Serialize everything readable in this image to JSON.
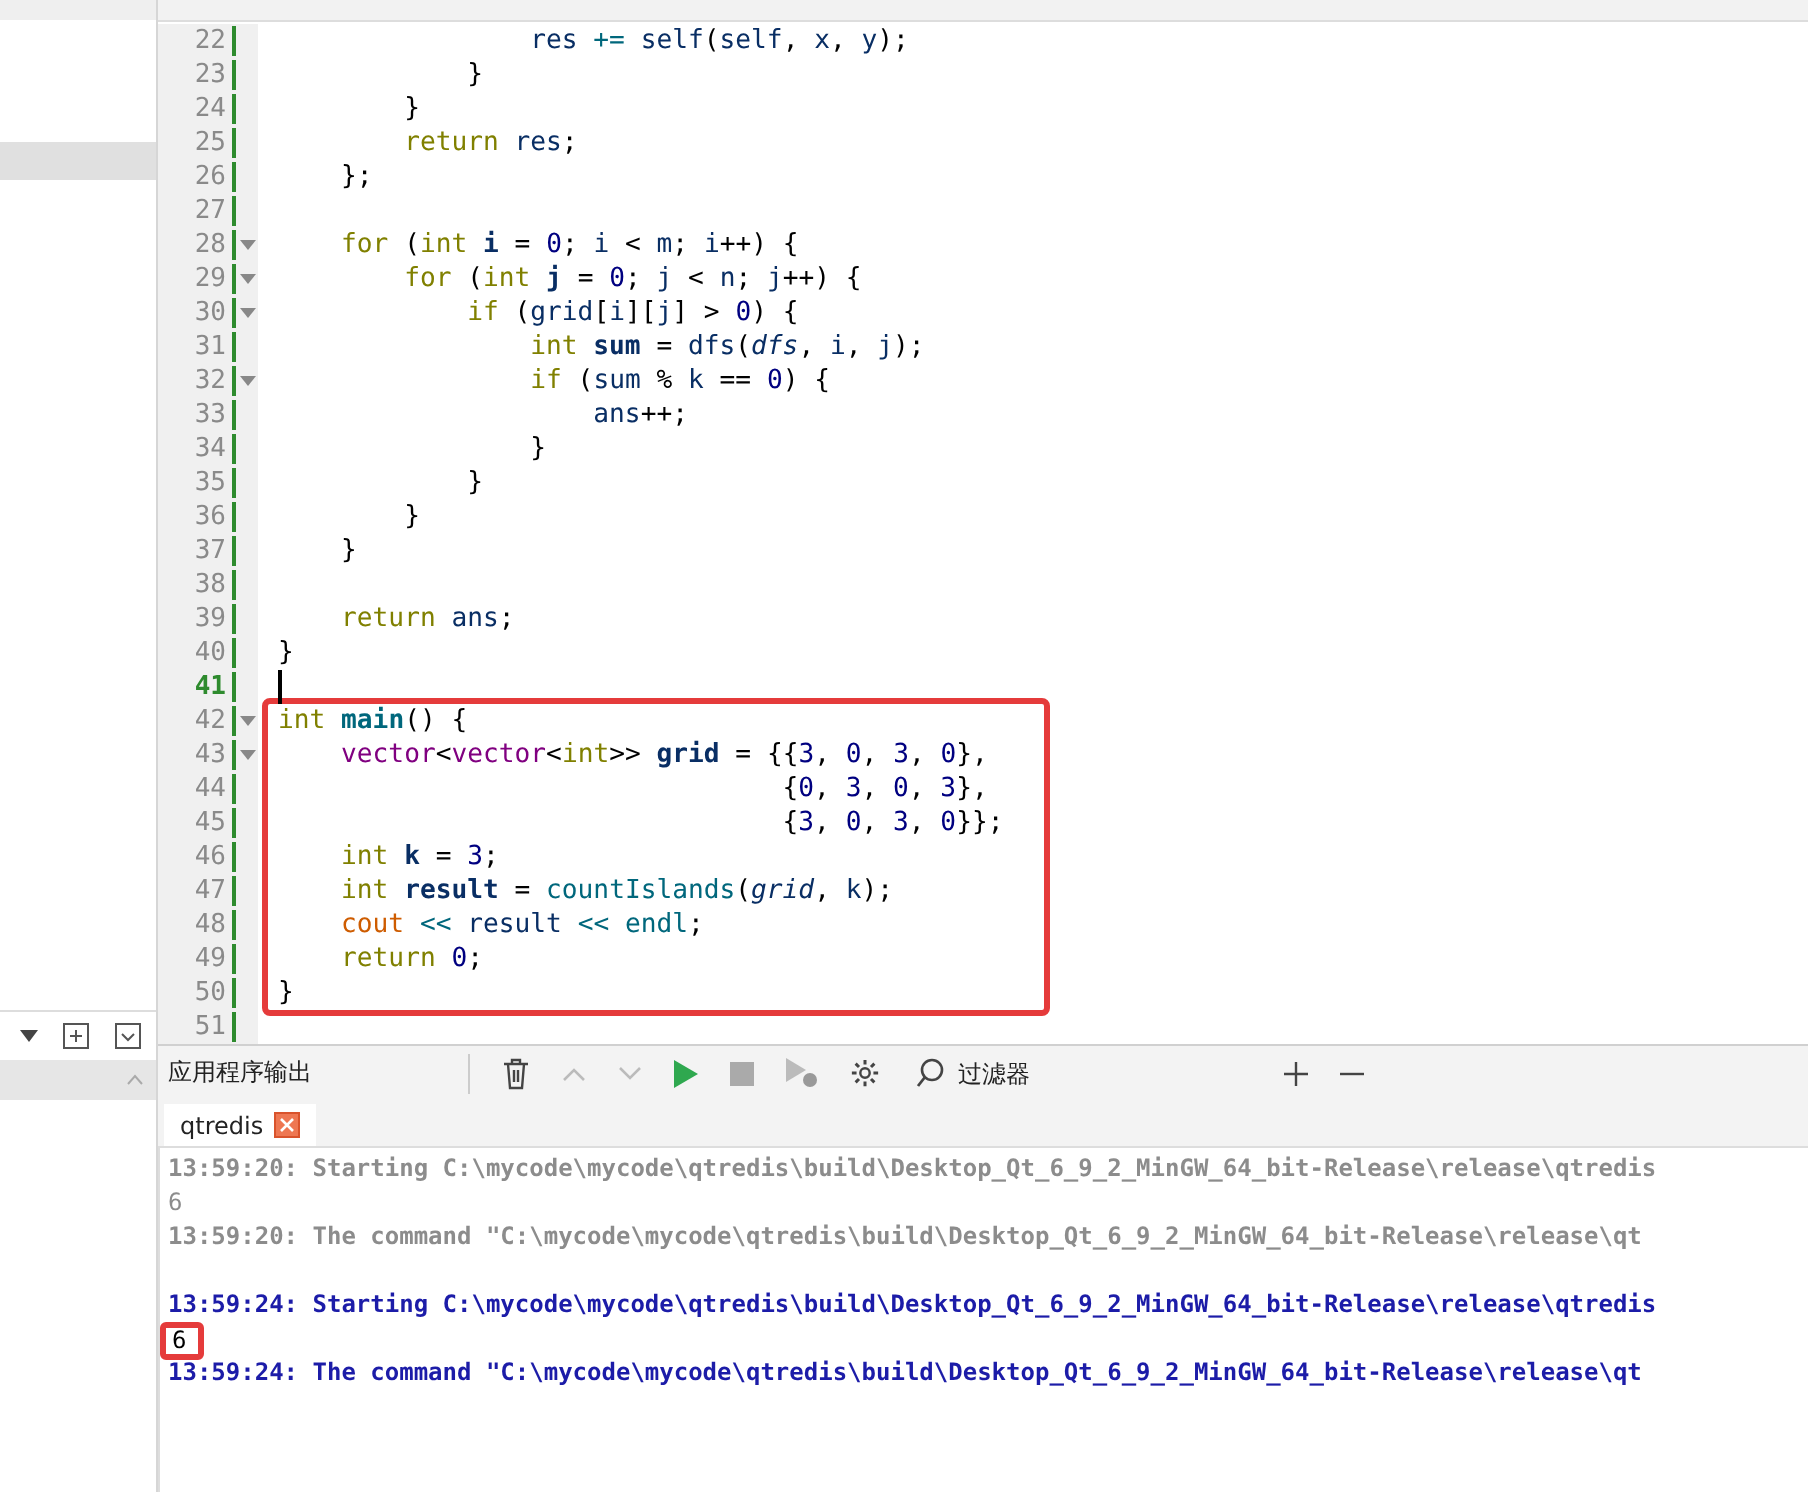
{
  "editor": {
    "lines": [
      {
        "number": "22",
        "fold": false,
        "current": false,
        "boxed": false,
        "tokens": [
          {
            "kind": "var",
            "text": "                res"
          },
          {
            "kind": "op",
            "text": " += "
          },
          {
            "kind": "var",
            "text": "self"
          },
          {
            "kind": "p",
            "text": "("
          },
          {
            "kind": "var",
            "text": "self"
          },
          {
            "kind": "p",
            "text": ", "
          },
          {
            "kind": "var",
            "text": "x"
          },
          {
            "kind": "p",
            "text": ", "
          },
          {
            "kind": "var",
            "text": "y"
          },
          {
            "kind": "p",
            "text": ");"
          }
        ]
      },
      {
        "number": "23",
        "fold": false,
        "current": false,
        "boxed": false,
        "tokens": [
          {
            "kind": "p",
            "text": "            }"
          }
        ]
      },
      {
        "number": "24",
        "fold": false,
        "current": false,
        "boxed": false,
        "tokens": [
          {
            "kind": "p",
            "text": "        }"
          }
        ]
      },
      {
        "number": "25",
        "fold": false,
        "current": false,
        "boxed": false,
        "tokens": [
          {
            "kind": "kw",
            "text": "        return"
          },
          {
            "kind": "var",
            "text": " res"
          },
          {
            "kind": "p",
            "text": ";"
          }
        ]
      },
      {
        "number": "26",
        "fold": false,
        "current": false,
        "boxed": false,
        "tokens": [
          {
            "kind": "p",
            "text": "    };"
          }
        ]
      },
      {
        "number": "27",
        "fold": false,
        "current": false,
        "boxed": false
      },
      {
        "number": "28",
        "fold": true,
        "current": false,
        "boxed": false,
        "tokens": [
          {
            "kind": "kw",
            "text": "    for"
          },
          {
            "kind": "p",
            "text": " ("
          },
          {
            "kind": "kw",
            "text": "int"
          },
          {
            "kind": "decl",
            "text": " i"
          },
          {
            "kind": "p",
            "text": " = "
          },
          {
            "kind": "num",
            "text": "0"
          },
          {
            "kind": "p",
            "text": "; "
          },
          {
            "kind": "var",
            "text": "i"
          },
          {
            "kind": "p",
            "text": " < "
          },
          {
            "kind": "var",
            "text": "m"
          },
          {
            "kind": "p",
            "text": "; "
          },
          {
            "kind": "var",
            "text": "i"
          },
          {
            "kind": "p",
            "text": "++) {"
          }
        ]
      },
      {
        "number": "29",
        "fold": true,
        "current": false,
        "boxed": false,
        "tokens": [
          {
            "kind": "kw",
            "text": "        for"
          },
          {
            "kind": "p",
            "text": " ("
          },
          {
            "kind": "kw",
            "text": "int"
          },
          {
            "kind": "decl",
            "text": " j"
          },
          {
            "kind": "p",
            "text": " = "
          },
          {
            "kind": "num",
            "text": "0"
          },
          {
            "kind": "p",
            "text": "; "
          },
          {
            "kind": "var",
            "text": "j"
          },
          {
            "kind": "p",
            "text": " < "
          },
          {
            "kind": "var",
            "text": "n"
          },
          {
            "kind": "p",
            "text": "; "
          },
          {
            "kind": "var",
            "text": "j"
          },
          {
            "kind": "p",
            "text": "++) {"
          }
        ]
      },
      {
        "number": "30",
        "fold": true,
        "current": false,
        "boxed": false,
        "tokens": [
          {
            "kind": "kw",
            "text": "            if"
          },
          {
            "kind": "p",
            "text": " ("
          },
          {
            "kind": "var",
            "text": "grid"
          },
          {
            "kind": "p",
            "text": "["
          },
          {
            "kind": "var",
            "text": "i"
          },
          {
            "kind": "p",
            "text": "]["
          },
          {
            "kind": "var",
            "text": "j"
          },
          {
            "kind": "p",
            "text": "] > "
          },
          {
            "kind": "num",
            "text": "0"
          },
          {
            "kind": "p",
            "text": ") {"
          }
        ]
      },
      {
        "number": "31",
        "fold": false,
        "current": false,
        "boxed": false,
        "tokens": [
          {
            "kind": "kw",
            "text": "                int"
          },
          {
            "kind": "decl",
            "text": " sum"
          },
          {
            "kind": "p",
            "text": " = "
          },
          {
            "kind": "var",
            "text": "dfs"
          },
          {
            "kind": "p",
            "text": "("
          },
          {
            "kind": "param",
            "text": "dfs"
          },
          {
            "kind": "p",
            "text": ", "
          },
          {
            "kind": "var",
            "text": "i"
          },
          {
            "kind": "p",
            "text": ", "
          },
          {
            "kind": "var",
            "text": "j"
          },
          {
            "kind": "p",
            "text": ");"
          }
        ]
      },
      {
        "number": "32",
        "fold": true,
        "current": false,
        "boxed": false,
        "tokens": [
          {
            "kind": "kw",
            "text": "                if"
          },
          {
            "kind": "p",
            "text": " ("
          },
          {
            "kind": "var",
            "text": "sum"
          },
          {
            "kind": "p",
            "text": " % "
          },
          {
            "kind": "var",
            "text": "k"
          },
          {
            "kind": "p",
            "text": " == "
          },
          {
            "kind": "num",
            "text": "0"
          },
          {
            "kind": "p",
            "text": ") {"
          }
        ]
      },
      {
        "number": "33",
        "fold": false,
        "current": false,
        "boxed": false,
        "tokens": [
          {
            "kind": "var",
            "text": "                    ans"
          },
          {
            "kind": "p",
            "text": "++;"
          }
        ]
      },
      {
        "number": "34",
        "fold": false,
        "current": false,
        "boxed": false,
        "tokens": [
          {
            "kind": "p",
            "text": "                }"
          }
        ]
      },
      {
        "number": "35",
        "fold": false,
        "current": false,
        "boxed": false,
        "tokens": [
          {
            "kind": "p",
            "text": "            }"
          }
        ]
      },
      {
        "number": "36",
        "fold": false,
        "current": false,
        "boxed": false,
        "tokens": [
          {
            "kind": "p",
            "text": "        }"
          }
        ]
      },
      {
        "number": "37",
        "fold": false,
        "current": false,
        "boxed": false,
        "tokens": [
          {
            "kind": "p",
            "text": "    }"
          }
        ]
      },
      {
        "number": "38",
        "fold": false,
        "current": false,
        "boxed": false
      },
      {
        "number": "39",
        "fold": false,
        "current": false,
        "boxed": false,
        "tokens": [
          {
            "kind": "kw",
            "text": "    return"
          },
          {
            "kind": "var",
            "text": " ans"
          },
          {
            "kind": "p",
            "text": ";"
          }
        ]
      },
      {
        "number": "40",
        "fold": false,
        "current": false,
        "boxed": false,
        "tokens": [
          {
            "kind": "p",
            "text": "}"
          }
        ]
      },
      {
        "number": "41",
        "fold": false,
        "current": true,
        "boxed": false
      },
      {
        "number": "42",
        "fold": true,
        "current": false,
        "boxed": true,
        "tokens": [
          {
            "kind": "kw",
            "text": "int"
          },
          {
            "kind": "fndecl",
            "text": " main"
          },
          {
            "kind": "p",
            "text": "() {"
          }
        ]
      },
      {
        "number": "43",
        "fold": true,
        "current": false,
        "boxed": true,
        "tokens": [
          {
            "kind": "type",
            "text": "    vector"
          },
          {
            "kind": "p",
            "text": "<"
          },
          {
            "kind": "type",
            "text": "vector"
          },
          {
            "kind": "p",
            "text": "<"
          },
          {
            "kind": "kw",
            "text": "int"
          },
          {
            "kind": "p",
            "text": ">> "
          },
          {
            "kind": "decl",
            "text": "grid"
          },
          {
            "kind": "p",
            "text": " = {{"
          },
          {
            "kind": "num",
            "text": "3"
          },
          {
            "kind": "p",
            "text": ", "
          },
          {
            "kind": "num",
            "text": "0"
          },
          {
            "kind": "p",
            "text": ", "
          },
          {
            "kind": "num",
            "text": "3"
          },
          {
            "kind": "p",
            "text": ", "
          },
          {
            "kind": "num",
            "text": "0"
          },
          {
            "kind": "p",
            "text": "},"
          }
        ]
      },
      {
        "number": "44",
        "fold": false,
        "current": false,
        "boxed": true,
        "tokens": [
          {
            "kind": "p",
            "text": "                                {"
          },
          {
            "kind": "num",
            "text": "0"
          },
          {
            "kind": "p",
            "text": ", "
          },
          {
            "kind": "num",
            "text": "3"
          },
          {
            "kind": "p",
            "text": ", "
          },
          {
            "kind": "num",
            "text": "0"
          },
          {
            "kind": "p",
            "text": ", "
          },
          {
            "kind": "num",
            "text": "3"
          },
          {
            "kind": "p",
            "text": "},"
          }
        ]
      },
      {
        "number": "45",
        "fold": false,
        "current": false,
        "boxed": true,
        "tokens": [
          {
            "kind": "p",
            "text": "                                {"
          },
          {
            "kind": "num",
            "text": "3"
          },
          {
            "kind": "p",
            "text": ", "
          },
          {
            "kind": "num",
            "text": "0"
          },
          {
            "kind": "p",
            "text": ", "
          },
          {
            "kind": "num",
            "text": "3"
          },
          {
            "kind": "p",
            "text": ", "
          },
          {
            "kind": "num",
            "text": "0"
          },
          {
            "kind": "p",
            "text": "}};"
          }
        ]
      },
      {
        "number": "46",
        "fold": false,
        "current": false,
        "boxed": true,
        "tokens": [
          {
            "kind": "kw",
            "text": "    int"
          },
          {
            "kind": "decl",
            "text": " k"
          },
          {
            "kind": "p",
            "text": " = "
          },
          {
            "kind": "num",
            "text": "3"
          },
          {
            "kind": "p",
            "text": ";"
          }
        ]
      },
      {
        "number": "47",
        "fold": false,
        "current": false,
        "boxed": true,
        "tokens": [
          {
            "kind": "kw",
            "text": "    int"
          },
          {
            "kind": "decl",
            "text": " result"
          },
          {
            "kind": "p",
            "text": " = "
          },
          {
            "kind": "fn",
            "text": "countIslands"
          },
          {
            "kind": "p",
            "text": "("
          },
          {
            "kind": "param",
            "text": "grid"
          },
          {
            "kind": "p",
            "text": ", "
          },
          {
            "kind": "var",
            "text": "k"
          },
          {
            "kind": "p",
            "text": ");"
          }
        ]
      },
      {
        "number": "48",
        "fold": false,
        "current": false,
        "boxed": true,
        "tokens": [
          {
            "kind": "global",
            "text": "    cout"
          },
          {
            "kind": "op",
            "text": " << "
          },
          {
            "kind": "var",
            "text": "result"
          },
          {
            "kind": "op",
            "text": " << "
          },
          {
            "kind": "fn",
            "text": "endl"
          },
          {
            "kind": "p",
            "text": ";"
          }
        ]
      },
      {
        "number": "49",
        "fold": false,
        "current": false,
        "boxed": true,
        "tokens": [
          {
            "kind": "kw",
            "text": "    return"
          },
          {
            "kind": "num",
            "text": " 0"
          },
          {
            "kind": "p",
            "text": ";"
          }
        ]
      },
      {
        "number": "50",
        "fold": false,
        "current": false,
        "boxed": true,
        "tokens": [
          {
            "kind": "p",
            "text": "}"
          }
        ]
      },
      {
        "number": "51",
        "fold": false,
        "current": false,
        "boxed": false
      }
    ]
  },
  "output": {
    "title": "应用程序输出",
    "filter": {
      "placeholder": "过滤器"
    },
    "tabs": [
      {
        "label": "qtredis",
        "selected": true
      }
    ],
    "lines": [
      {
        "kind": "old-msg",
        "boxed": false,
        "text": "13:59:20: Starting C:\\mycode\\mycode\\qtredis\\build\\Desktop_Qt_6_9_2_MinGW_64_bit-Release\\release\\qtredis"
      },
      {
        "kind": "old-out",
        "boxed": false,
        "text": "6"
      },
      {
        "kind": "old-msg",
        "boxed": false,
        "text": "13:59:20: The command \"C:\\mycode\\mycode\\qtredis\\build\\Desktop_Qt_6_9_2_MinGW_64_bit-Release\\release\\qt"
      },
      {
        "kind": "blank"
      },
      {
        "kind": "new-msg",
        "boxed": false,
        "text": "13:59:24: Starting C:\\mycode\\mycode\\qtredis\\build\\Desktop_Qt_6_9_2_MinGW_64_bit-Release\\release\\qtredis"
      },
      {
        "kind": "new-out",
        "boxed": true,
        "text": "6"
      },
      {
        "kind": "new-msg",
        "boxed": false,
        "text": "13:59:24: The command \"C:\\mycode\\mycode\\qtredis\\build\\Desktop_Qt_6_9_2_MinGW_64_bit-Release\\release\\qt"
      }
    ]
  }
}
